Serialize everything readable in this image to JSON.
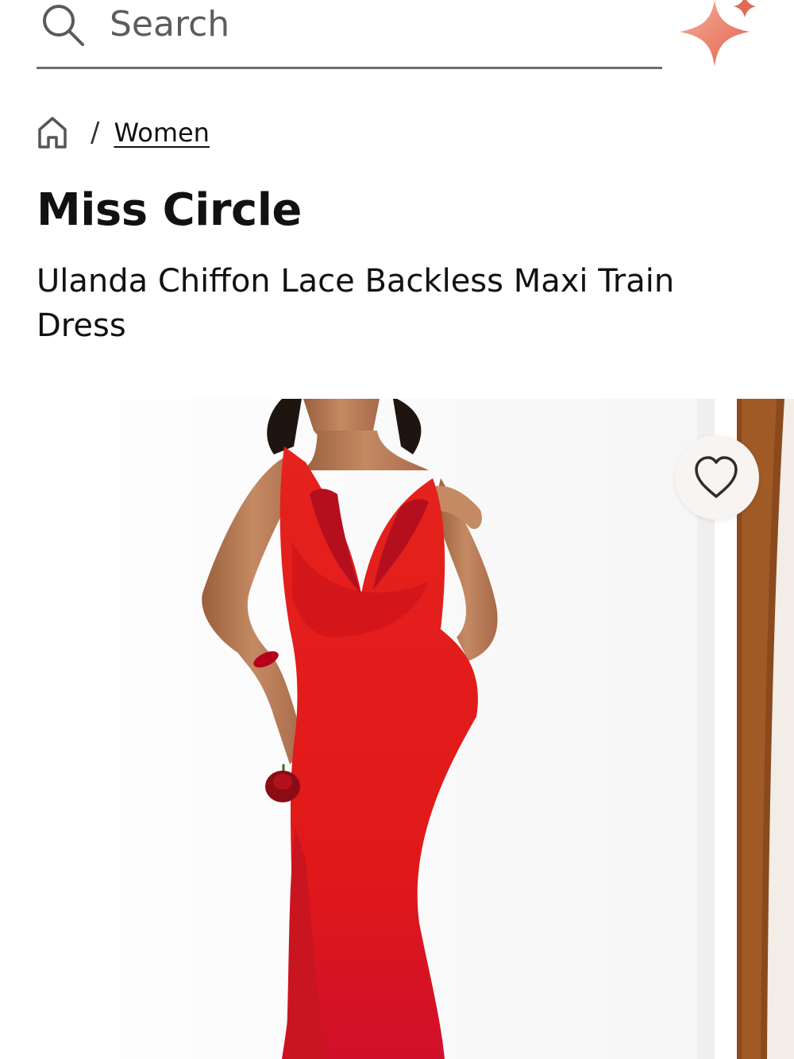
{
  "search": {
    "placeholder": "Search",
    "value": ""
  },
  "icons": {
    "search": "search-icon",
    "assistant": "sparkle-icon",
    "home": "home-icon",
    "wishlist": "heart-icon"
  },
  "breadcrumb": {
    "separator": "/",
    "items": [
      {
        "label": "Women"
      }
    ]
  },
  "product": {
    "brand": "Miss Circle",
    "name": "Ulanda Chiffon Lace Backless Maxi Train Dress"
  },
  "colors": {
    "accent": "#e8705a",
    "dress": "#e3181a",
    "divider": "#6f6f6f"
  }
}
